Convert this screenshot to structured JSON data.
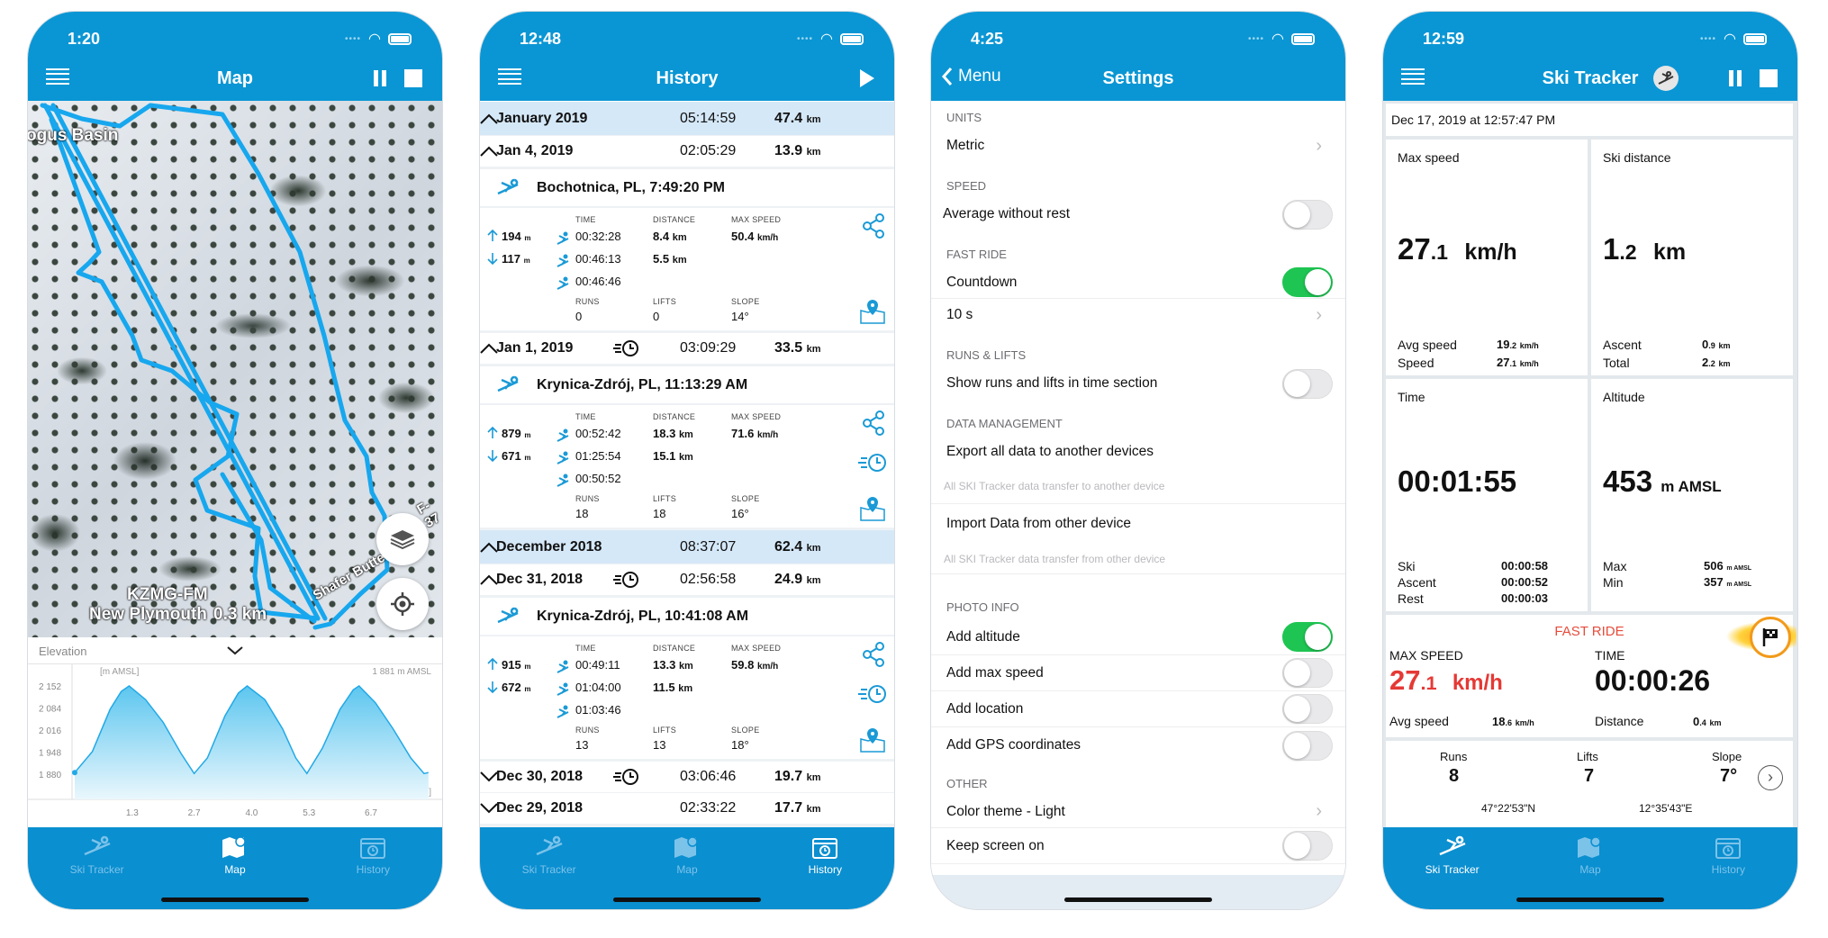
{
  "colors": {
    "brand_blue": "#0a96d4",
    "month_row": "#d5e8f8",
    "toggle_on": "#1ec552",
    "fast_ride_red": "#e53935"
  },
  "tabs": [
    {
      "label": "Ski Tracker",
      "icon": "skier-icon"
    },
    {
      "label": "Map",
      "icon": "map-icon"
    },
    {
      "label": "History",
      "icon": "calendar-clock-icon"
    }
  ],
  "map_screen": {
    "status_time": "1:20",
    "title": "Map",
    "labels": {
      "place1": "ogus Basin",
      "place2": "KZMG-FM",
      "place3": "New Plymouth",
      "scale": "0.3 km",
      "road": "Shafer Butte",
      "road2": "F-37"
    },
    "elevation": {
      "header": "Elevation",
      "y_unit": "[m AMSL]",
      "current": "1 881 m AMSL",
      "x_unit": "[km]"
    },
    "active_tab": 1
  },
  "chart_data": {
    "type": "area",
    "title": "Elevation",
    "xlabel": "[km]",
    "ylabel": "[m AMSL]",
    "y_ticks": [
      "2 152",
      "2 084",
      "2 016",
      "1 948",
      "1 880"
    ],
    "y_tick_values": [
      2152,
      2084,
      2016,
      1948,
      1880
    ],
    "x_ticks": [
      "1.3",
      "2.7",
      "4.0",
      "5.3",
      "6.7"
    ],
    "x_tick_values": [
      1.3,
      2.7,
      4.0,
      5.3,
      6.7
    ],
    "xlim": [
      0,
      8.0
    ],
    "ylim": [
      1880,
      2152
    ],
    "x": [
      0,
      0.4,
      0.8,
      1.05,
      1.23,
      1.6,
      2.0,
      2.4,
      2.7,
      3.0,
      3.4,
      3.7,
      3.9,
      4.3,
      4.7,
      5.0,
      5.25,
      5.6,
      6.0,
      6.3,
      6.43,
      6.8,
      7.2,
      7.6,
      7.9,
      8.0
    ],
    "y": [
      1885,
      1950,
      2080,
      2135,
      2152,
      2110,
      2040,
      1945,
      1882,
      1930,
      2060,
      2130,
      2152,
      2110,
      2020,
      1930,
      1882,
      1960,
      2080,
      2140,
      2152,
      2100,
      2020,
      1930,
      1882,
      1885
    ],
    "grid": false
  },
  "history_screen": {
    "status_time": "12:48",
    "title": "History",
    "active_tab": 2,
    "labels": {
      "time": "TIME",
      "distance": "DISTANCE",
      "max_speed": "MAX SPEED",
      "runs": "RUNS",
      "lifts": "LIFTS",
      "slope": "SLOPE",
      "m": "m",
      "km": "km",
      "kmh": "km/h"
    },
    "months": [
      {
        "label": "January 2019",
        "time": "05:14:59",
        "dist": "47.4",
        "expanded": true,
        "days": [
          {
            "date": "Jan 4, 2019",
            "fast_ride": false,
            "time": "02:05:29",
            "dist": "13.9",
            "expanded": true,
            "sessions": [
              {
                "title": "Bochotnica, PL, 7:49:20 PM",
                "ascent": "194",
                "descent": "117",
                "ski_time": "00:32:28",
                "lift_time": "00:46:13",
                "rest_time": "00:46:46",
                "ski_dist": "8.4",
                "lift_dist": "5.5",
                "max_speed": "50.4",
                "runs": "0",
                "lifts": "0",
                "slope": "14°",
                "fast_ride": false
              }
            ]
          },
          {
            "date": "Jan 1, 2019",
            "fast_ride": true,
            "time": "03:09:29",
            "dist": "33.5",
            "expanded": true,
            "sessions": [
              {
                "title": "Krynica-Zdrój, PL, 11:13:29 AM",
                "ascent": "879",
                "descent": "671",
                "ski_time": "00:52:42",
                "lift_time": "01:25:54",
                "rest_time": "00:50:52",
                "ski_dist": "18.3",
                "lift_dist": "15.1",
                "max_speed": "71.6",
                "runs": "18",
                "lifts": "18",
                "slope": "16°",
                "fast_ride": true
              }
            ]
          }
        ]
      },
      {
        "label": "December 2018",
        "time": "08:37:07",
        "dist": "62.4",
        "expanded": true,
        "days": [
          {
            "date": "Dec 31, 2018",
            "fast_ride": true,
            "time": "02:56:58",
            "dist": "24.9",
            "expanded": true,
            "sessions": [
              {
                "title": "Krynica-Zdrój, PL, 10:41:08 AM",
                "ascent": "915",
                "descent": "672",
                "ski_time": "00:49:11",
                "lift_time": "01:04:00",
                "rest_time": "01:03:46",
                "ski_dist": "13.3",
                "lift_dist": "11.5",
                "max_speed": "59.8",
                "runs": "13",
                "lifts": "13",
                "slope": "18°",
                "fast_ride": true
              }
            ]
          },
          {
            "date": "Dec 30, 2018",
            "fast_ride": true,
            "time": "03:06:46",
            "dist": "19.7",
            "expanded": false,
            "sessions": []
          },
          {
            "date": "Dec 29, 2018",
            "fast_ride": false,
            "time": "02:33:22",
            "dist": "17.7",
            "expanded": false,
            "sessions": []
          }
        ]
      }
    ]
  },
  "settings_screen": {
    "status_time": "4:25",
    "back_label": "Menu",
    "title": "Settings",
    "units_header": "UNITS",
    "metric": "Metric",
    "speed_header": "SPEED",
    "avg_without_rest": "Average without rest",
    "avg_without_rest_on": false,
    "fast_ride_header": "FAST RIDE",
    "countdown": "Countdown",
    "countdown_on": true,
    "countdown_value": "10 s",
    "runs_header": "RUNS & LIFTS",
    "show_runs": "Show runs and lifts in time section",
    "show_runs_on": false,
    "data_header": "DATA MANAGEMENT",
    "export": "Export all data to another devices",
    "export_sub": "All SKI Tracker data transfer to another device",
    "import": "Import Data from other device",
    "import_sub": "All SKI Tracker data transfer from other device",
    "photo_header": "PHOTO INFO",
    "add_altitude": "Add altitude",
    "add_altitude_on": true,
    "add_max_speed": "Add max speed",
    "add_max_speed_on": false,
    "add_location": "Add location",
    "add_location_on": false,
    "add_gps": "Add GPS coordinates",
    "add_gps_on": false,
    "other_header": "OTHER",
    "color_theme": "Color theme - Light",
    "keep_screen": "Keep screen on",
    "keep_screen_on": false
  },
  "tracker_screen": {
    "status_time": "12:59",
    "title": "Ski Tracker",
    "active_tab": 0,
    "date": "Dec 17, 2019 at 12:57:47 PM",
    "max_speed": {
      "label": "Max speed",
      "value": "27.1",
      "unit": "km/h",
      "avg_label": "Avg speed",
      "avg": "19.2",
      "speed_label": "Speed",
      "speed": "27.1",
      "sub_unit": "km/h"
    },
    "ski_distance": {
      "label": "Ski distance",
      "value": "1.2",
      "unit": "km",
      "ascent_label": "Ascent",
      "ascent": "0.9",
      "total_label": "Total",
      "total": "2.2",
      "sub_unit": "km"
    },
    "time": {
      "label": "Time",
      "value": "00:01:55",
      "ski_label": "Ski",
      "ski": "00:00:58",
      "ascent_label": "Ascent",
      "ascent": "00:00:52",
      "rest_label": "Rest",
      "rest": "00:00:03"
    },
    "altitude": {
      "label": "Altitude",
      "value": "453",
      "unit": "m AMSL",
      "max_label": "Max",
      "max": "506",
      "min_label": "Min",
      "min": "357",
      "sub_unit": "m AMSL"
    },
    "fast_ride": {
      "title": "FAST RIDE",
      "max_speed_label": "MAX SPEED",
      "max_speed": "27.1",
      "unit": "km/h",
      "time_label": "TIME",
      "time": "00:00:26",
      "avg_label": "Avg speed",
      "avg": "18.6",
      "distance_label": "Distance",
      "distance": "0.4",
      "dist_unit": "km"
    },
    "runs_label": "Runs",
    "runs": "8",
    "lifts_label": "Lifts",
    "lifts": "7",
    "slope_label": "Slope",
    "slope": "7°",
    "lat": "47°22'53\"N",
    "lon": "12°35'43\"E"
  }
}
